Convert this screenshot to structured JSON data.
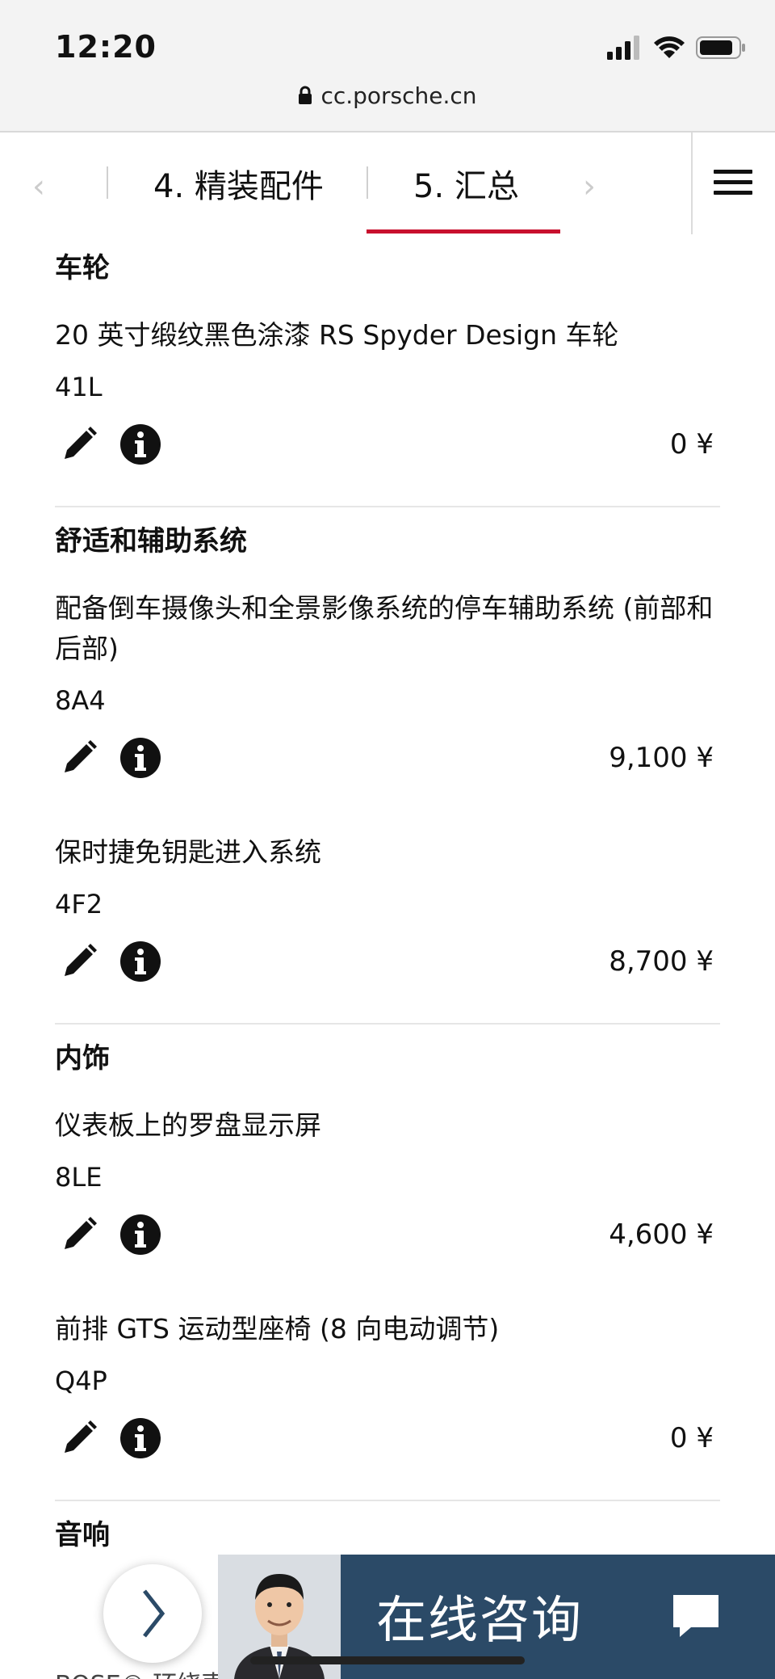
{
  "status_bar": {
    "time": "12:20"
  },
  "browser": {
    "url": "cc.porsche.cn"
  },
  "stepnav": {
    "prev_arrow": "‹",
    "next_arrow": "›",
    "tab4_label": "4. 精装配件",
    "tab5_label": "5. 汇总"
  },
  "sections": [
    {
      "title": "车轮",
      "items": [
        {
          "name": "20 英寸缎纹黑色涂漆 RS Spyder Design 车轮",
          "code": "41L",
          "price": "0 ¥"
        }
      ]
    },
    {
      "title": "舒适和辅助系统",
      "items": [
        {
          "name": "配备倒车摄像头和全景影像系统的停车辅助系统 (前部和后部)",
          "code": "8A4",
          "price": "9,100 ¥"
        },
        {
          "name": "保时捷免钥匙进入系统",
          "code": "4F2",
          "price": "8,700 ¥"
        }
      ]
    },
    {
      "title": "内饰",
      "items": [
        {
          "name": "仪表板上的罗盘显示屏",
          "code": "8LE",
          "price": "4,600 ¥"
        },
        {
          "name": "前排 GTS 运动型座椅 (8 向电动调节)",
          "code": "Q4P",
          "price": "0 ¥"
        }
      ]
    }
  ],
  "cut_off": {
    "section_title": "音响",
    "next_item": "BOSE® 环绕声"
  },
  "chat": {
    "label": "在线咨询"
  },
  "icons": {
    "edit": "pencil-icon",
    "info": "info-icon",
    "menu": "hamburger-menu-icon",
    "chat": "chat-bubble-icon",
    "float": "chevron-right-icon"
  },
  "colors": {
    "accent": "#c8102e",
    "chat_bar": "#2b4a67",
    "chrome_bg": "#f3f3f3"
  }
}
